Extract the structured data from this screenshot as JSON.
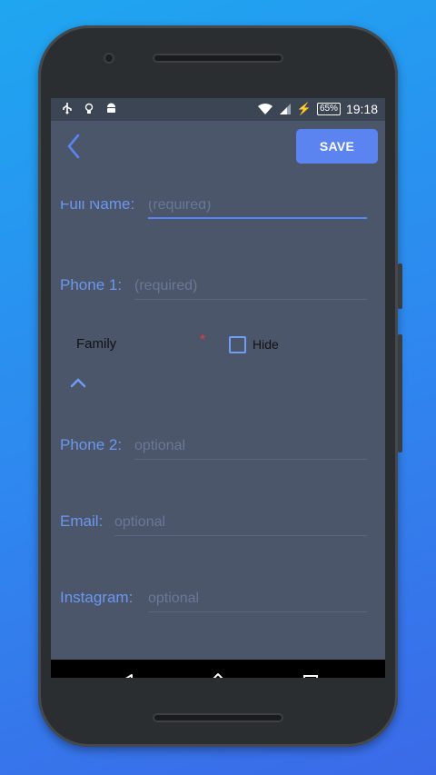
{
  "status_bar": {
    "left_icons": [
      "usb-icon",
      "lightbulb-icon",
      "android-icon"
    ],
    "wifi": "wifi-icon",
    "signal": "signal-icon",
    "charging": "charging-icon",
    "battery_percent": "65%",
    "time": "19:18"
  },
  "app_bar": {
    "back": "back-arrow-icon",
    "save_label": "SAVE"
  },
  "form": {
    "full_name": {
      "label": "Full Name:",
      "placeholder": "(required)"
    },
    "phone1": {
      "label": "Phone 1:",
      "placeholder": "(required)"
    },
    "group": {
      "value": "Family",
      "required_mark": "*",
      "hide_label": "Hide"
    },
    "phone2": {
      "label": "Phone 2:",
      "placeholder": "optional"
    },
    "email": {
      "label": "Email:",
      "placeholder": "optional"
    },
    "instagram": {
      "label": "Instagram:",
      "placeholder": "optional"
    }
  },
  "nav": [
    "back-triangle-icon",
    "home-icon",
    "recents-square-icon"
  ],
  "colors": {
    "accent": "#5b84f1",
    "screen_bg": "#4c566b",
    "label": "#6a98ef"
  }
}
